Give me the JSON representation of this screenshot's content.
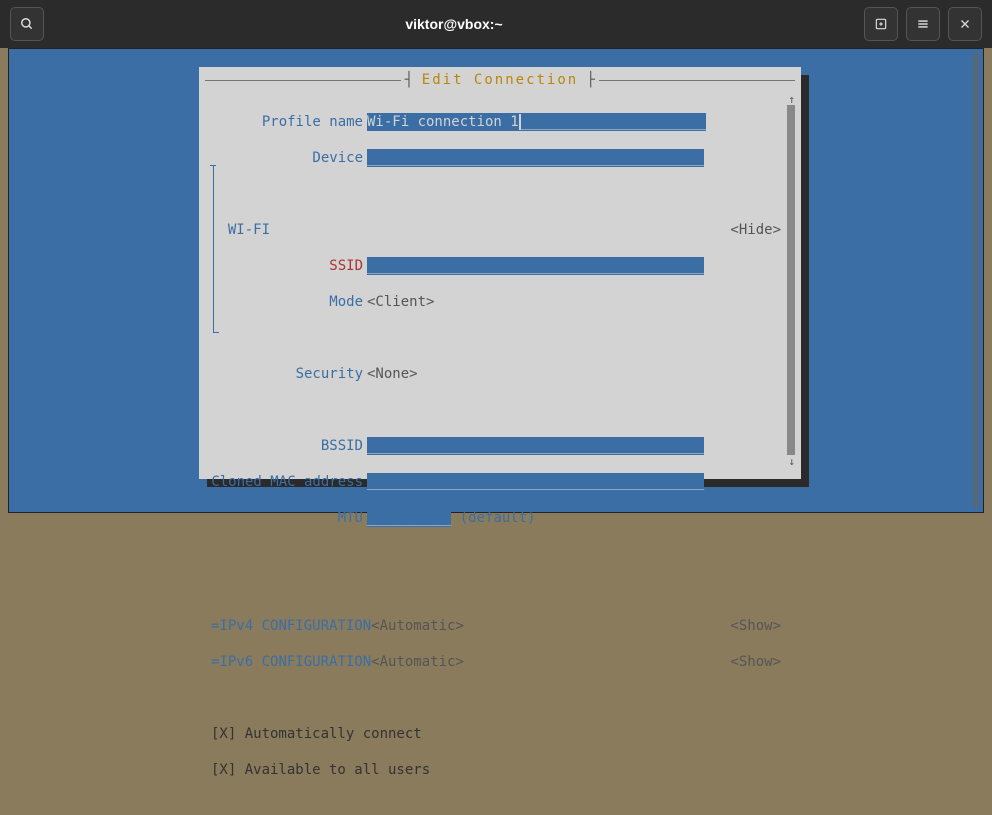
{
  "titlebar": {
    "title": "viktor@vbox:~"
  },
  "tui": {
    "window_title": "Edit Connection",
    "profile_name_label": "Profile name",
    "profile_name_value": "Wi-Fi connection 1",
    "device_label": "Device",
    "device_value": "",
    "wifi_section": "WI-FI",
    "wifi_toggle": "<Hide>",
    "ssid_label": "SSID",
    "ssid_value": "",
    "mode_label": "Mode",
    "mode_value": "<Client>",
    "security_label": "Security",
    "security_value": "<None>",
    "bssid_label": "BSSID",
    "bssid_value": "",
    "cloned_mac_label": "Cloned MAC address",
    "cloned_mac_value": "",
    "mtu_label": "MTU",
    "mtu_value": "",
    "mtu_hint": "(default)",
    "ipv4_label": "IPv4 CONFIGURATION",
    "ipv4_value": "<Automatic>",
    "ipv4_toggle": "<Show>",
    "ipv6_label": "IPv6 CONFIGURATION",
    "ipv6_value": "<Automatic>",
    "ipv6_toggle": "<Show>",
    "auto_connect": "[X] Automatically connect",
    "all_users": "[X] Available to all users",
    "field_pad_40": "________________________________________",
    "field_pad_22": "______________________",
    "field_pad_10": "__________",
    "eq": "="
  }
}
